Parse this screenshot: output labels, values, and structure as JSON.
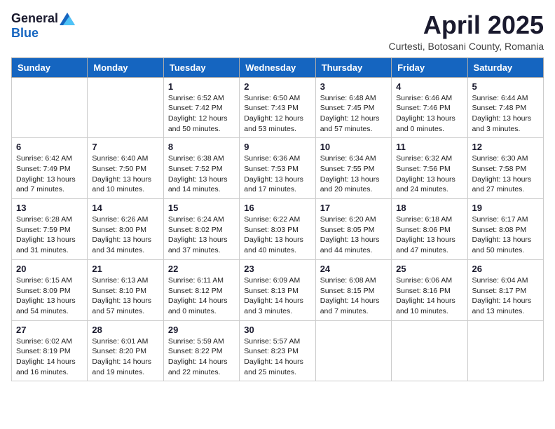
{
  "logo": {
    "general": "General",
    "blue": "Blue"
  },
  "title": "April 2025",
  "location": "Curtesti, Botosani County, Romania",
  "weekdays": [
    "Sunday",
    "Monday",
    "Tuesday",
    "Wednesday",
    "Thursday",
    "Friday",
    "Saturday"
  ],
  "weeks": [
    [
      {
        "day": "",
        "info": ""
      },
      {
        "day": "",
        "info": ""
      },
      {
        "day": "1",
        "info": "Sunrise: 6:52 AM\nSunset: 7:42 PM\nDaylight: 12 hours and 50 minutes."
      },
      {
        "day": "2",
        "info": "Sunrise: 6:50 AM\nSunset: 7:43 PM\nDaylight: 12 hours and 53 minutes."
      },
      {
        "day": "3",
        "info": "Sunrise: 6:48 AM\nSunset: 7:45 PM\nDaylight: 12 hours and 57 minutes."
      },
      {
        "day": "4",
        "info": "Sunrise: 6:46 AM\nSunset: 7:46 PM\nDaylight: 13 hours and 0 minutes."
      },
      {
        "day": "5",
        "info": "Sunrise: 6:44 AM\nSunset: 7:48 PM\nDaylight: 13 hours and 3 minutes."
      }
    ],
    [
      {
        "day": "6",
        "info": "Sunrise: 6:42 AM\nSunset: 7:49 PM\nDaylight: 13 hours and 7 minutes."
      },
      {
        "day": "7",
        "info": "Sunrise: 6:40 AM\nSunset: 7:50 PM\nDaylight: 13 hours and 10 minutes."
      },
      {
        "day": "8",
        "info": "Sunrise: 6:38 AM\nSunset: 7:52 PM\nDaylight: 13 hours and 14 minutes."
      },
      {
        "day": "9",
        "info": "Sunrise: 6:36 AM\nSunset: 7:53 PM\nDaylight: 13 hours and 17 minutes."
      },
      {
        "day": "10",
        "info": "Sunrise: 6:34 AM\nSunset: 7:55 PM\nDaylight: 13 hours and 20 minutes."
      },
      {
        "day": "11",
        "info": "Sunrise: 6:32 AM\nSunset: 7:56 PM\nDaylight: 13 hours and 24 minutes."
      },
      {
        "day": "12",
        "info": "Sunrise: 6:30 AM\nSunset: 7:58 PM\nDaylight: 13 hours and 27 minutes."
      }
    ],
    [
      {
        "day": "13",
        "info": "Sunrise: 6:28 AM\nSunset: 7:59 PM\nDaylight: 13 hours and 31 minutes."
      },
      {
        "day": "14",
        "info": "Sunrise: 6:26 AM\nSunset: 8:00 PM\nDaylight: 13 hours and 34 minutes."
      },
      {
        "day": "15",
        "info": "Sunrise: 6:24 AM\nSunset: 8:02 PM\nDaylight: 13 hours and 37 minutes."
      },
      {
        "day": "16",
        "info": "Sunrise: 6:22 AM\nSunset: 8:03 PM\nDaylight: 13 hours and 40 minutes."
      },
      {
        "day": "17",
        "info": "Sunrise: 6:20 AM\nSunset: 8:05 PM\nDaylight: 13 hours and 44 minutes."
      },
      {
        "day": "18",
        "info": "Sunrise: 6:18 AM\nSunset: 8:06 PM\nDaylight: 13 hours and 47 minutes."
      },
      {
        "day": "19",
        "info": "Sunrise: 6:17 AM\nSunset: 8:08 PM\nDaylight: 13 hours and 50 minutes."
      }
    ],
    [
      {
        "day": "20",
        "info": "Sunrise: 6:15 AM\nSunset: 8:09 PM\nDaylight: 13 hours and 54 minutes."
      },
      {
        "day": "21",
        "info": "Sunrise: 6:13 AM\nSunset: 8:10 PM\nDaylight: 13 hours and 57 minutes."
      },
      {
        "day": "22",
        "info": "Sunrise: 6:11 AM\nSunset: 8:12 PM\nDaylight: 14 hours and 0 minutes."
      },
      {
        "day": "23",
        "info": "Sunrise: 6:09 AM\nSunset: 8:13 PM\nDaylight: 14 hours and 3 minutes."
      },
      {
        "day": "24",
        "info": "Sunrise: 6:08 AM\nSunset: 8:15 PM\nDaylight: 14 hours and 7 minutes."
      },
      {
        "day": "25",
        "info": "Sunrise: 6:06 AM\nSunset: 8:16 PM\nDaylight: 14 hours and 10 minutes."
      },
      {
        "day": "26",
        "info": "Sunrise: 6:04 AM\nSunset: 8:17 PM\nDaylight: 14 hours and 13 minutes."
      }
    ],
    [
      {
        "day": "27",
        "info": "Sunrise: 6:02 AM\nSunset: 8:19 PM\nDaylight: 14 hours and 16 minutes."
      },
      {
        "day": "28",
        "info": "Sunrise: 6:01 AM\nSunset: 8:20 PM\nDaylight: 14 hours and 19 minutes."
      },
      {
        "day": "29",
        "info": "Sunrise: 5:59 AM\nSunset: 8:22 PM\nDaylight: 14 hours and 22 minutes."
      },
      {
        "day": "30",
        "info": "Sunrise: 5:57 AM\nSunset: 8:23 PM\nDaylight: 14 hours and 25 minutes."
      },
      {
        "day": "",
        "info": ""
      },
      {
        "day": "",
        "info": ""
      },
      {
        "day": "",
        "info": ""
      }
    ]
  ]
}
